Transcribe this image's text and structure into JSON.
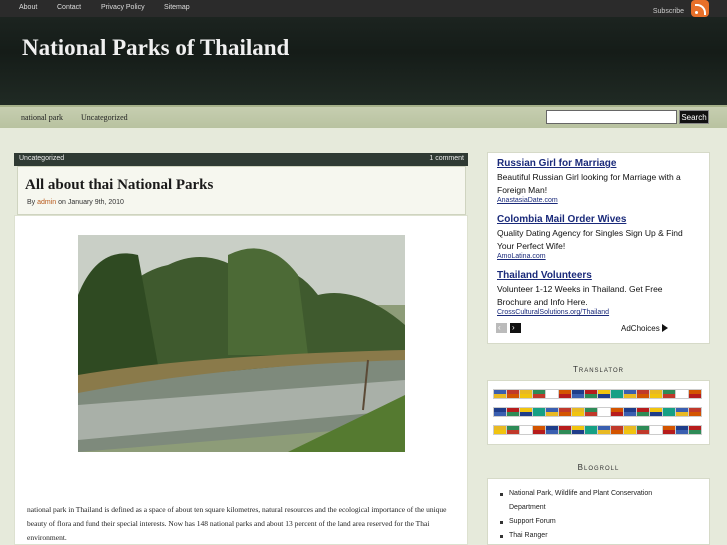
{
  "topnav": {
    "items": [
      "About",
      "Contact",
      "Privacy Policy",
      "Sitemap"
    ],
    "subscribe": "Subscribe"
  },
  "header": {
    "title": "National Parks of Thailand"
  },
  "categories": [
    "national park",
    "Uncategorized"
  ],
  "search": {
    "button": "Search",
    "placeholder": ""
  },
  "post": {
    "category": "Uncategorized",
    "comments": "1 comment",
    "title": "All about thai National Parks",
    "by": "By",
    "author": "admin",
    "date": "on January 9th, 2010",
    "body": "national park in Thailand is defined as a space of about ten square kilometres, natural resources and the ecological importance of the unique beauty of flora and fund their special interests. Now has 148 national parks and about 13 percent of the land area reserved for the Thai environment."
  },
  "ads": [
    {
      "title": "Russian Girl for Marriage",
      "desc": "Beautiful Russian Girl looking for Marriage with a Foreign Man!",
      "url": "AnastasiaDate.com"
    },
    {
      "title": "Colombia Mail Order Wives",
      "desc": "Quality Dating Agency for Singles Sign Up & Find Your Perfect Wife!",
      "url": "AmoLatina.com"
    },
    {
      "title": "Thailand Volunteers",
      "desc": "Volunteer 1-12 Weeks in Thailand. Get Free Brochure and Info Here.",
      "url": "CrossCulturalSolutions.org/Thailand"
    }
  ],
  "adchoices": "AdChoices",
  "translator": {
    "title": "Translator"
  },
  "blogroll": {
    "title": "Blogroll",
    "items": [
      "National Park, Wildlife and Plant Conservation Department",
      "Support Forum",
      "Thai Ranger"
    ]
  },
  "colors": {
    "header_bg": "#151c18",
    "link": "#1a2a7a",
    "accent": "#b85a1c"
  }
}
